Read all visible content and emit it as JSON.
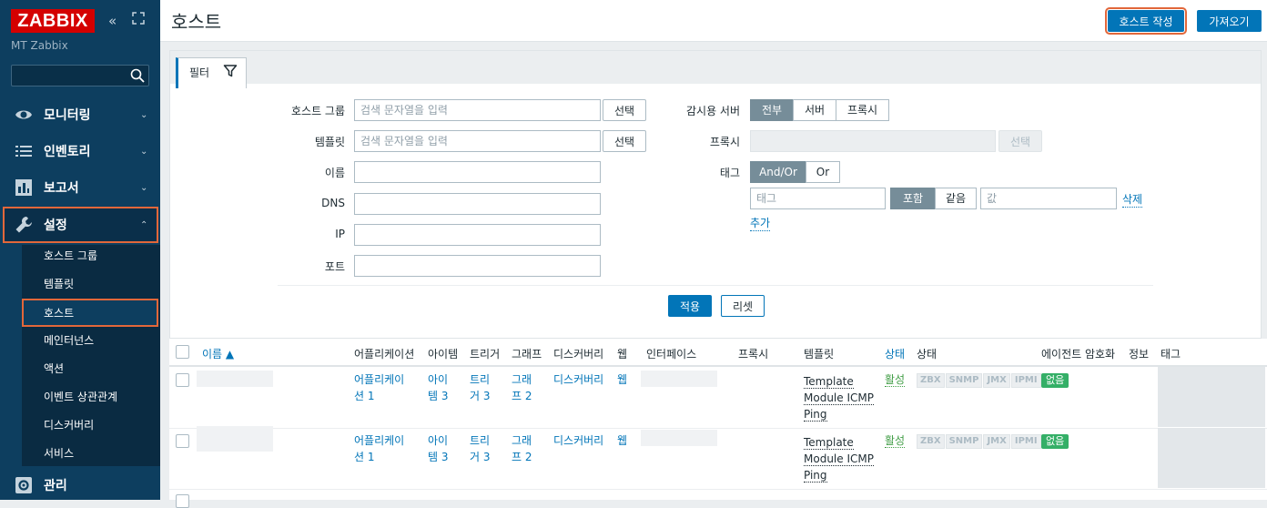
{
  "sidebar": {
    "logo": "ZABBIX",
    "server_name": "MT Zabbix",
    "menu": [
      {
        "label": "모니터링",
        "icon": "eye-icon"
      },
      {
        "label": "인벤토리",
        "icon": "list-icon"
      },
      {
        "label": "보고서",
        "icon": "bar-chart-icon"
      },
      {
        "label": "설정",
        "icon": "wrench-icon"
      },
      {
        "label": "관리",
        "icon": "gear-icon"
      }
    ],
    "submenu": [
      "호스트 그룹",
      "템플릿",
      "호스트",
      "메인터넌스",
      "액션",
      "이벤트 상관관계",
      "디스커버리",
      "서비스"
    ]
  },
  "header": {
    "title": "호스트",
    "create_button": "호스트 작성",
    "import_button": "가져오기"
  },
  "filter": {
    "tab_label": "필터",
    "host_group_label": "호스트 그룹",
    "template_label": "템플릿",
    "name_label": "이름",
    "dns_label": "DNS",
    "ip_label": "IP",
    "port_label": "포트",
    "search_placeholder": "검색 문자열을 입력",
    "select_button": "선택",
    "monitored_by_label": "감시용 서버",
    "monitored_by_options": [
      "전부",
      "서버",
      "프록시"
    ],
    "proxy_label": "프록시",
    "tags_label": "태그",
    "tag_logic": [
      "And/Or",
      "Or"
    ],
    "tag_placeholder": "태그",
    "tag_operators": [
      "포함",
      "같음"
    ],
    "value_placeholder": "값",
    "remove_link": "삭제",
    "add_link": "추가",
    "apply_button": "적용",
    "reset_button": "리셋"
  },
  "table": {
    "columns": [
      "이름 ▲",
      "어플리케이션",
      "아이템",
      "트리거",
      "그래프",
      "디스커버리",
      "웹",
      "인터페이스",
      "프록시",
      "템플릿",
      "상태",
      "상태",
      "에이전트 암호화",
      "정보",
      "태그"
    ],
    "rows": [
      {
        "applications": [
          "어플리케이",
          "션 1"
        ],
        "items": [
          "아이",
          "템 3"
        ],
        "triggers": [
          "트리",
          "거 3"
        ],
        "graphs": [
          "그래",
          "프 2"
        ],
        "discovery": "디스커버리",
        "web": "웹",
        "template": [
          "Template",
          "Module ICMP",
          "Ping"
        ],
        "status": "활성",
        "availability": [
          "ZBX",
          "SNMP",
          "JMX",
          "IPMI"
        ],
        "encryption": "없음"
      },
      {
        "applications": [
          "어플리케이",
          "션 1"
        ],
        "items": [
          "아이",
          "템 3"
        ],
        "triggers": [
          "트리",
          "거 3"
        ],
        "graphs": [
          "그래",
          "프 2"
        ],
        "discovery": "디스커버리",
        "web": "웹",
        "template": [
          "Template",
          "Module ICMP",
          "Ping"
        ],
        "status": "활성",
        "availability": [
          "ZBX",
          "SNMP",
          "JMX",
          "IPMI"
        ],
        "encryption": "없음"
      }
    ]
  },
  "colors": {
    "sidebar_bg": "#0d3e5f",
    "accent_blue": "#0275b8",
    "highlight_orange": "#e2673a",
    "status_green": "#429e47",
    "logo_red": "#d40000"
  }
}
